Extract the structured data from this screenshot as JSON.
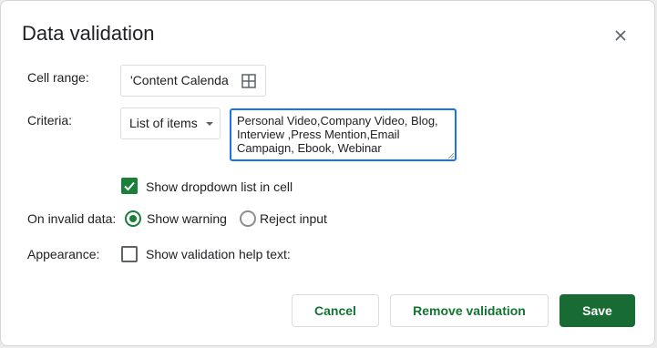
{
  "dialog": {
    "title": "Data validation",
    "close_icon": "close-icon"
  },
  "cell_range": {
    "label": "Cell range:",
    "value": "'Content Calenda",
    "icon": "grid-select-icon"
  },
  "criteria": {
    "label": "Criteria:",
    "type_selected": "List of items",
    "items_text": "Personal Video,Company Video, Blog,\nInterview ,Press Mention,Email Campaign, Ebook, Webinar"
  },
  "show_dropdown": {
    "label": "Show dropdown list in cell",
    "checked": true
  },
  "on_invalid": {
    "label": "On invalid data:",
    "options": [
      {
        "label": "Show warning",
        "selected": true
      },
      {
        "label": "Reject input",
        "selected": false
      }
    ]
  },
  "appearance": {
    "label": "Appearance:",
    "help_text_label": "Show validation help text:",
    "checked": false
  },
  "buttons": {
    "cancel": "Cancel",
    "remove": "Remove validation",
    "save": "Save"
  },
  "colors": {
    "accent_green": "#188038",
    "focus_blue": "#1a73e8",
    "save_bg": "#186b32"
  }
}
